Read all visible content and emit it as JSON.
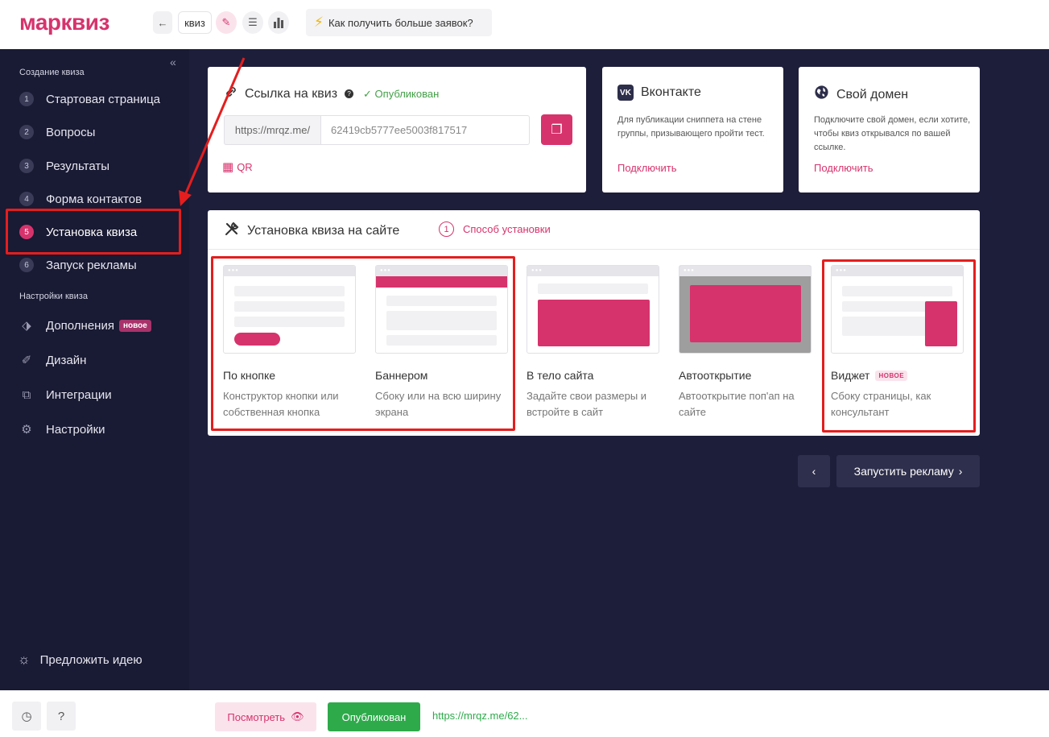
{
  "header": {
    "logo": "марквиз",
    "back_icon": "←",
    "quiz_name": "квиз",
    "edit_icon": "✎",
    "list_icon": "☰",
    "stats_icon": "▮",
    "tip_icon": "⚡",
    "tip_label": "Как получить больше заявок?"
  },
  "sidebar": {
    "collapse_icon": "«",
    "section_create": "Создание квиза",
    "steps": [
      {
        "num": "1",
        "label": "Стартовая страница"
      },
      {
        "num": "2",
        "label": "Вопросы"
      },
      {
        "num": "3",
        "label": "Результаты"
      },
      {
        "num": "4",
        "label": "Форма контактов"
      },
      {
        "num": "5",
        "label": "Установка квиза"
      },
      {
        "num": "6",
        "label": "Запуск рекламы"
      }
    ],
    "active_step": 5,
    "section_settings": "Настройки квиза",
    "nav": [
      {
        "icon": "⬗",
        "label": "Дополнения",
        "badge": "новое"
      },
      {
        "icon": "✐",
        "label": "Дизайн"
      },
      {
        "icon": "⧉",
        "label": "Интеграции"
      },
      {
        "icon": "⚙",
        "label": "Настройки"
      }
    ],
    "idea_icon": "☼",
    "idea_label": "Предложить идею"
  },
  "link_card": {
    "icon": "🔗",
    "title": "Ссылка на квиз",
    "help": "?",
    "status": "✓ Опубликован",
    "prefix": "https://mrqz.me/",
    "slug": "62419cb5777ee5003f817517",
    "copy_icon": "❐",
    "qr_icon": "▦",
    "qr_label": "QR"
  },
  "vk_card": {
    "icon": "VK",
    "title": "Вконтакте",
    "desc": "Для публикации сниппета на стене группы, призывающего пройти тест.",
    "link": "Подключить"
  },
  "domain_card": {
    "icon": "🌐",
    "title": "Свой домен",
    "desc": "Подключите свой домен, если хотите, чтобы квиз открывался по вашей ссылке.",
    "link": "Подключить"
  },
  "install": {
    "icon": "✕",
    "title": "Установка квиза на сайте",
    "method_num": "1",
    "method_label": "Способ установки",
    "options": [
      {
        "name": "По кнопке",
        "desc": "Конструктор кнопки или собственная кнопка"
      },
      {
        "name": "Баннером",
        "desc": "Сбоку или на всю ширину экрана"
      },
      {
        "name": "В тело сайта",
        "desc": "Задайте свои размеры и встройте в сайт"
      },
      {
        "name": "Автооткрытие",
        "desc": "Автооткрытие поп'ап на сайте"
      },
      {
        "name": "Виджет",
        "badge": "НОВОЕ",
        "desc": "Сбоку страницы, как консультант"
      }
    ]
  },
  "navigation": {
    "prev_icon": "‹",
    "next_label": "Запустить рекламу",
    "next_icon": "›"
  },
  "footer": {
    "history_icon": "◷",
    "help_icon": "?",
    "preview_label": "Посмотреть",
    "preview_icon": "👁",
    "published_label": "Опубликован",
    "link": "https://mrqz.me/62..."
  },
  "colors": {
    "accent": "#d6336c",
    "sidebar_bg": "#191a33",
    "main_bg": "#1d1e3a",
    "success": "#2eaa4b",
    "annotation": "#e41e1e"
  }
}
